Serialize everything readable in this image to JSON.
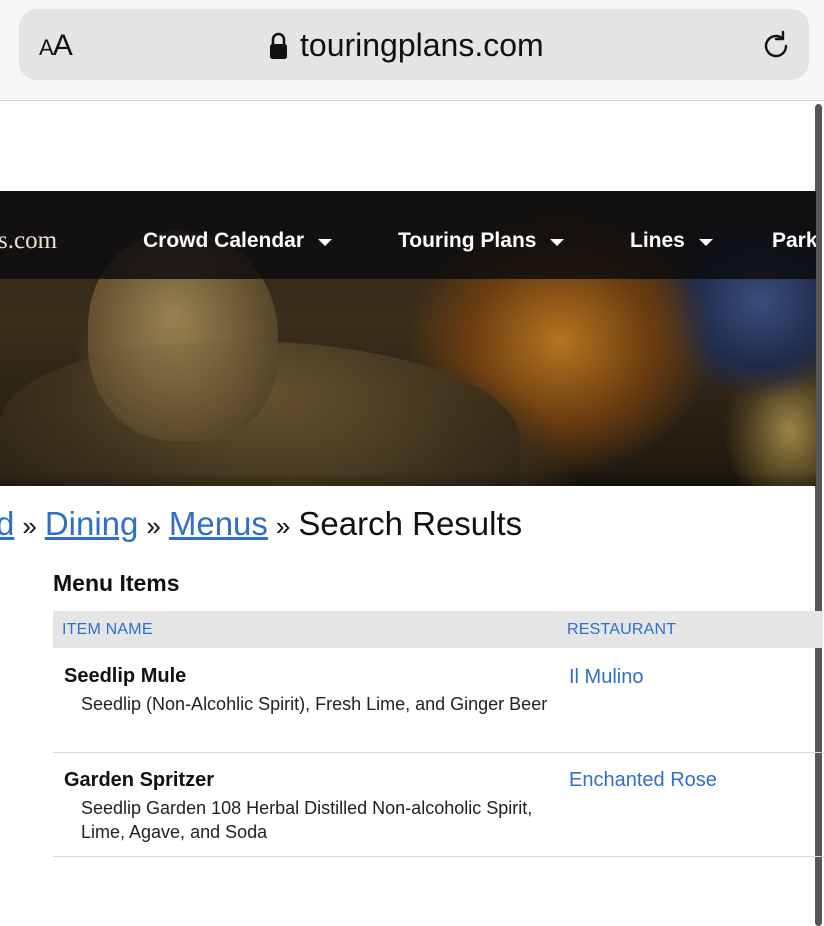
{
  "browser": {
    "text_size_label_small": "A",
    "text_size_label_large": "A",
    "url": "touringplans.com"
  },
  "nav": {
    "logo_text": "s.com",
    "items": [
      {
        "label": "Crowd Calendar"
      },
      {
        "label": "Touring Plans"
      },
      {
        "label": "Lines"
      },
      {
        "label": "Parks"
      }
    ]
  },
  "breadcrumb": {
    "items": [
      {
        "label": "d"
      },
      {
        "label": "Dining"
      },
      {
        "label": "Menus"
      }
    ],
    "separator": "»",
    "current": "Search Results"
  },
  "menu_items": {
    "title": "Menu Items",
    "columns": [
      "ITEM NAME",
      "RESTAURANT"
    ],
    "rows": [
      {
        "name": "Seedlip Mule",
        "description": "Seedlip (Non-Alcohlic Spirit), Fresh Lime, and Ginger Beer",
        "restaurant": "Il Mulino"
      },
      {
        "name": "Garden Spritzer",
        "description": "Seedlip Garden 108 Herbal Distilled Non-alcoholic Spirit, Lime, Agave, and Soda",
        "restaurant": "Enchanted Rose"
      }
    ]
  },
  "colors": {
    "link": "#2f6fc8",
    "nav_background": "#0c0c0e",
    "table_header_background": "#e5e5e5"
  }
}
